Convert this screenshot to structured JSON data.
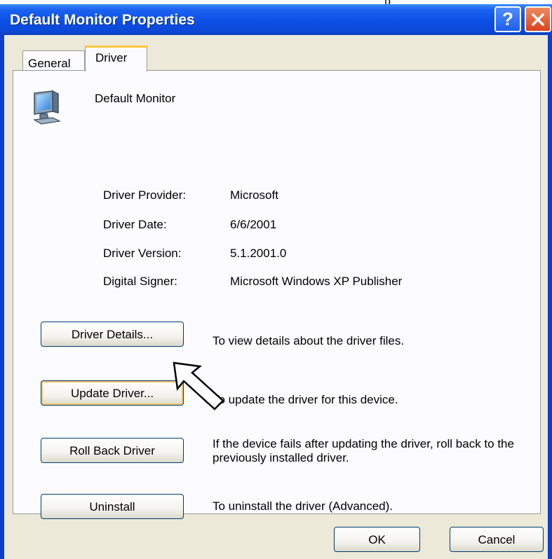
{
  "top_fragment": "p",
  "window": {
    "title": "Default Monitor Properties",
    "help_glyph": "?"
  },
  "tabs": [
    {
      "label": "General",
      "active": false
    },
    {
      "label": "Driver",
      "active": true
    }
  ],
  "device": {
    "icon": "monitor-icon",
    "name": "Default Monitor"
  },
  "driver_info": [
    {
      "label": "Driver Provider:",
      "value": "Microsoft"
    },
    {
      "label": "Driver Date:",
      "value": "6/6/2001"
    },
    {
      "label": "Driver Version:",
      "value": "5.1.2001.0"
    },
    {
      "label": "Digital Signer:",
      "value": "Microsoft Windows XP Publisher"
    }
  ],
  "actions": [
    {
      "label": "Driver Details...",
      "description": "To view details about the driver files."
    },
    {
      "label": "Update Driver...",
      "description": "To update the driver for this device.",
      "focused": true
    },
    {
      "label": "Roll Back Driver",
      "description": "If the device fails after updating the driver, roll back to the previously installed driver."
    },
    {
      "label": "Uninstall",
      "description": "To uninstall the driver (Advanced)."
    }
  ],
  "footer": {
    "ok_label": "OK",
    "cancel_label": "Cancel"
  },
  "colors": {
    "titlebar": "#0b49d8",
    "dialog_face": "#ece9d8",
    "focus_border": "#f4c46c",
    "close_button": "#d8431e"
  }
}
